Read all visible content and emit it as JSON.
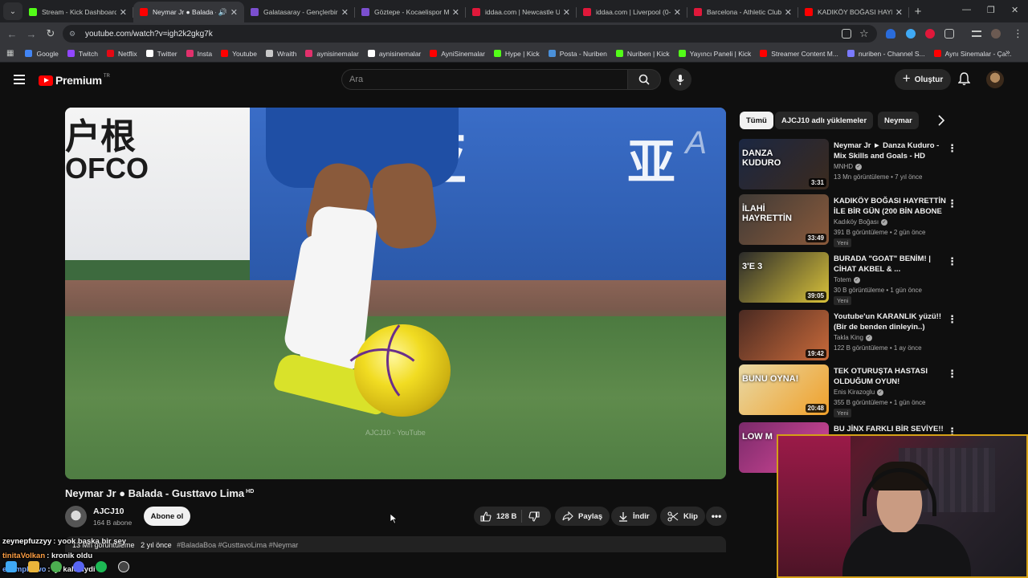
{
  "browser": {
    "tabs": [
      {
        "title": "Stream - Kick Dashboard",
        "color": "#53fc18",
        "active": false
      },
      {
        "title": "Neymar Jr ● Balada -",
        "color": "#ff0000",
        "active": true
      },
      {
        "title": "Galatasaray - Gençlerbirliğ",
        "color": "#7b4fcf",
        "active": false
      },
      {
        "title": "Göztepe - Kocaelispor Ma",
        "color": "#7b4fcf",
        "active": false
      },
      {
        "title": "iddaa.com | Newcastle Un",
        "color": "#e0183a",
        "active": false
      },
      {
        "title": "iddaa.com | Liverpool (0-",
        "color": "#e0183a",
        "active": false
      },
      {
        "title": "Barcelona - Athletic Club",
        "color": "#e0183a",
        "active": false
      },
      {
        "title": "KADIKÖY BOĞASI HAYRE",
        "color": "#ff0000",
        "active": false
      }
    ],
    "url": "youtube.com/watch?v=igh2k2gkg7k",
    "bookmarks": [
      {
        "label": "Google",
        "color": "#4285f4"
      },
      {
        "label": "Twitch",
        "color": "#9146ff"
      },
      {
        "label": "Netflix",
        "color": "#e50914"
      },
      {
        "label": "Twitter",
        "color": "#ffffff"
      },
      {
        "label": "Insta",
        "color": "#e1306c"
      },
      {
        "label": "Youtube",
        "color": "#ff0000"
      },
      {
        "label": "Wraith",
        "color": "#c8c8c8"
      },
      {
        "label": "aynisinemalar",
        "color": "#e1306c"
      },
      {
        "label": "aynisinemalar",
        "color": "#ffffff"
      },
      {
        "label": "AyniSinemalar",
        "color": "#ff0000"
      },
      {
        "label": "Hype | Kick",
        "color": "#53fc18"
      },
      {
        "label": "Posta - Nuriben",
        "color": "#4a90d9"
      },
      {
        "label": "Nuriben | Kick",
        "color": "#53fc18"
      },
      {
        "label": "Yayıncı Paneli | Kick",
        "color": "#53fc18"
      },
      {
        "label": "Streamer Content M...",
        "color": "#ff0000"
      },
      {
        "label": "nuriben - Channel S...",
        "color": "#7a7aff"
      },
      {
        "label": "Aynı Sinemalar - Ça...",
        "color": "#ff0000"
      }
    ]
  },
  "youtube": {
    "logo_text": "Premium",
    "country": "TR",
    "search_placeholder": "Ara",
    "create_label": "Oluştur"
  },
  "video": {
    "title": "Neymar Jr ● Balada - Gusttavo Lima",
    "hd": "HD",
    "watermark": "AJCJ10 - YouTube",
    "ad_text_left": "户根",
    "ad_text_ofco": "OFCO",
    "channel_name": "AJCJ10",
    "channel_subs": "164 B abone",
    "subscribe_label": "Abone ol",
    "likes": "128 B",
    "share_label": "Paylaş",
    "download_label": "İndir",
    "clip_label": "Klip",
    "views": "13 Mn görüntüleme",
    "age": "2 yıl önce",
    "hashtags": "#BaladaBoa #GusttavoLima #Neymar"
  },
  "rail": {
    "chips": [
      "Tümü",
      "AJCJ10 adlı yüklemeler",
      "Neymar"
    ],
    "items": [
      {
        "title": "Neymar Jr ► Danza Kuduro - Mix Skills and Goals - HD",
        "channel": "MNHD",
        "meta": "13 Mn görüntüleme • 7 yıl önce",
        "duration": "3:31",
        "badge": "",
        "thumb_text": "DANZA KUDURO",
        "colors": [
          "#1b2742",
          "#3b2a1e"
        ]
      },
      {
        "title": "KADIKÖY BOĞASI HAYRETTİN İLE BİR GÜN (200 BİN ABONE ...",
        "channel": "Kadıköy Boğası",
        "meta": "391 B görüntüleme • 2 gün önce",
        "duration": "33:49",
        "badge": "Yeni",
        "thumb_text": "İLAHİ HAYRETTİN",
        "colors": [
          "#3f3a36",
          "#8a5a3b"
        ]
      },
      {
        "title": "BURADA \"GOAT\" BENİM! | CİHAT AKBEL & ...",
        "channel": "Totem",
        "meta": "30 B görüntüleme • 1 gün önce",
        "duration": "39:05",
        "badge": "Yeni",
        "thumb_text": "3'E 3",
        "colors": [
          "#2a2a2a",
          "#d9c23a"
        ]
      },
      {
        "title": "Youtube'un KARANLIK yüzü!! (Bir de benden dinleyin..)",
        "channel": "Takla King",
        "meta": "122 B görüntüleme • 1 ay önce",
        "duration": "19:42",
        "badge": "",
        "thumb_text": "",
        "colors": [
          "#4a2a22",
          "#c96a3a"
        ]
      },
      {
        "title": "TEK OTURUŞTA HASTASI OLDUĞUM OYUN!",
        "channel": "Enis Kirazoglu",
        "meta": "355 B görüntüleme • 1 gün önce",
        "duration": "20:48",
        "badge": "Yeni",
        "thumb_text": "BUNU OYNA!",
        "colors": [
          "#e8d9a6",
          "#f0a02a"
        ]
      },
      {
        "title": "BU JİNX FARKLI BİR SEVİYE!!",
        "channel": "",
        "meta": "",
        "duration": "",
        "badge": "",
        "thumb_text": "LOW M",
        "colors": [
          "#7a2a6a",
          "#d94a9a"
        ]
      }
    ]
  },
  "chat": [
    {
      "user": "zeynepfuzzyy",
      "text": ": yook başka bir şey",
      "color": "#ffffff"
    },
    {
      "user": "tinitaVolkan",
      "text": ": kronik oldu",
      "color": "#ff9f43"
    },
    {
      "user": "exampletwo",
      "text": ": iyi kaleciydi",
      "color": "#7aa7ff"
    }
  ]
}
